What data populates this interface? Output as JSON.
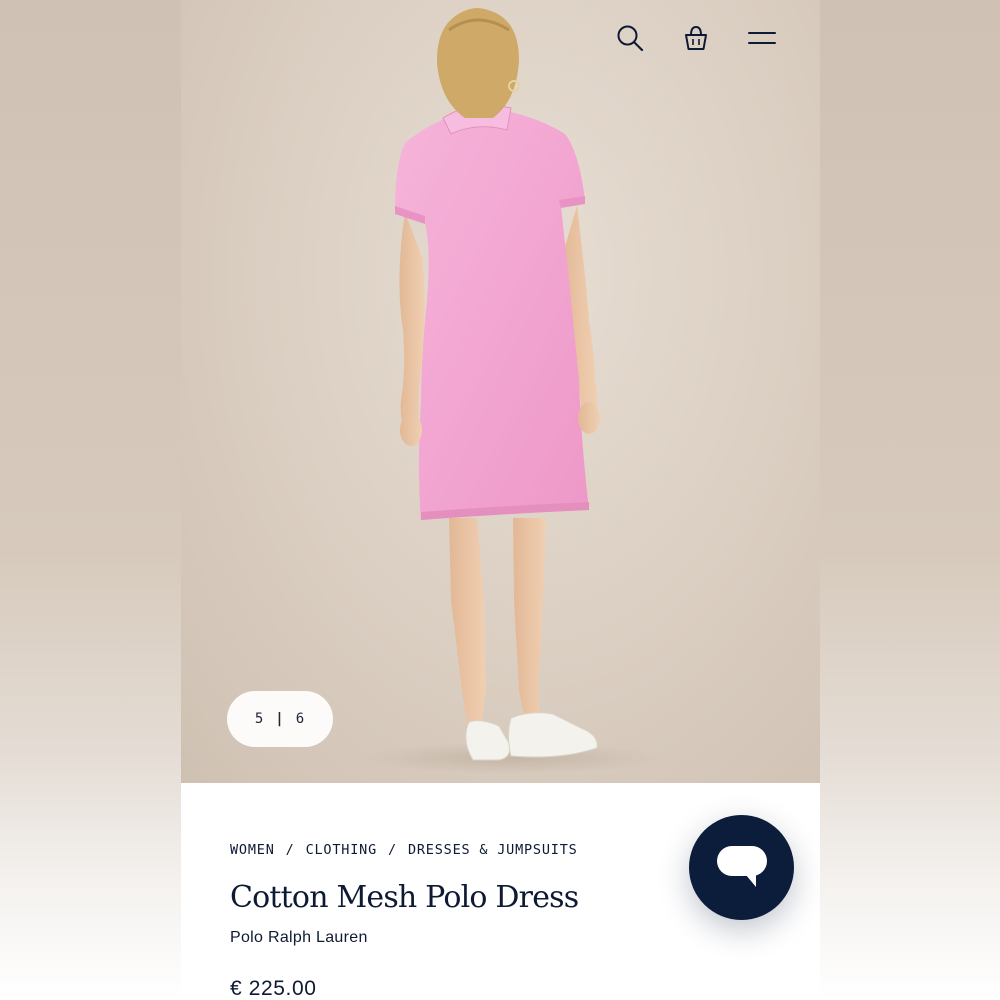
{
  "gallery": {
    "current": "5",
    "total": "6",
    "separator": "|",
    "image_description_icon": "product-photo"
  },
  "header": {
    "search_icon": "search-icon",
    "bag_icon": "shopping-bag-icon",
    "menu_icon": "hamburger-menu-icon"
  },
  "breadcrumb": {
    "items": [
      "WOMEN",
      "CLOTHING",
      "DRESSES & JUMPSUITS"
    ],
    "separator": "/"
  },
  "product": {
    "title": "Cotton Mesh Polo Dress",
    "brand": "Polo Ralph Lauren",
    "price": "€ 225.00"
  },
  "chat": {
    "icon": "chat-bubble-icon"
  },
  "colors": {
    "navy": "#0b1d3a",
    "text": "#0e1a33",
    "dress_pink": "#f3a6d2",
    "backdrop": "#ddd1c5"
  }
}
